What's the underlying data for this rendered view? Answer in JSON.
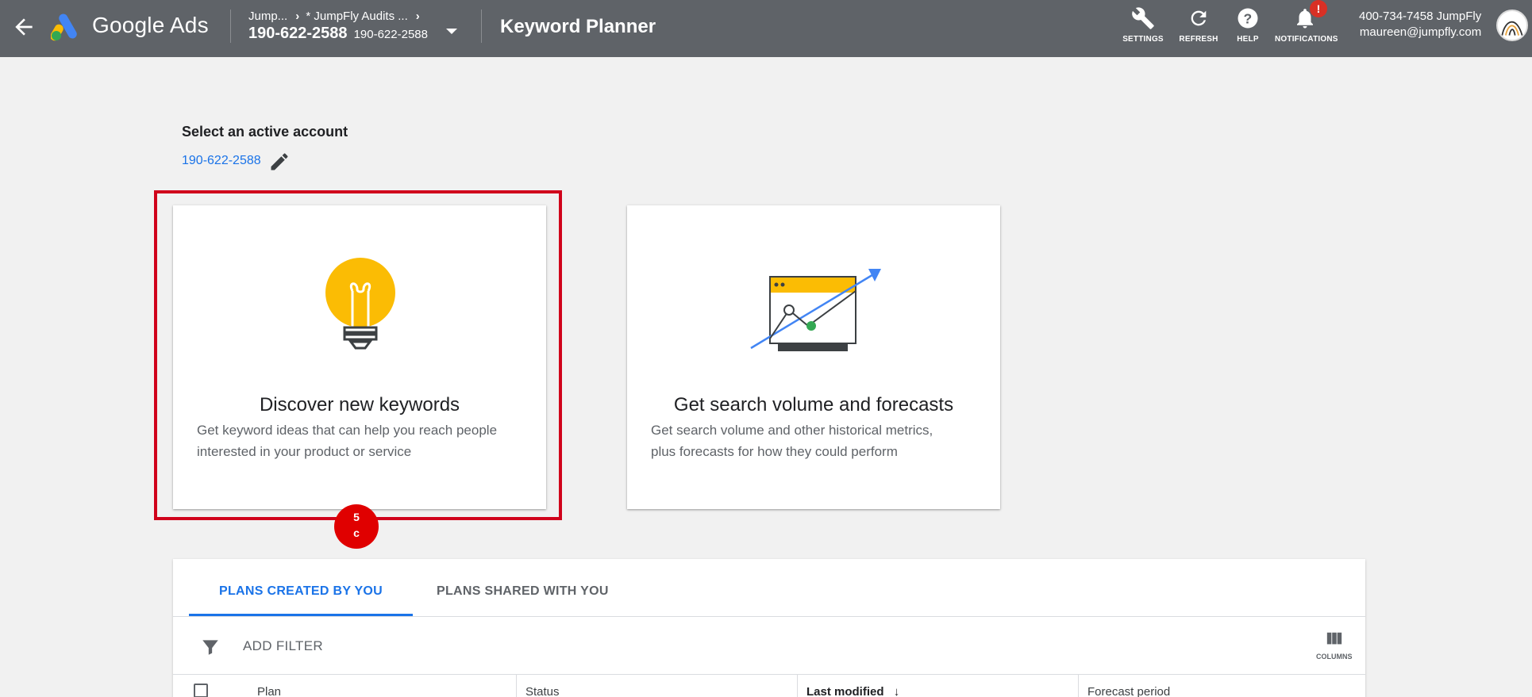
{
  "header": {
    "brand": "Google Ads",
    "breadcrumb": {
      "item1": "Jump...",
      "item2": "* JumpFly Audits ...",
      "account_id": "190-622-2588",
      "account_sub": "190-622-2588"
    },
    "page_title": "Keyword Planner",
    "tools": {
      "settings": "SETTINGS",
      "refresh": "REFRESH",
      "help": "HELP",
      "notifications": "NOTIFICATIONS",
      "notification_badge": "!"
    },
    "account": {
      "line1": "400-734-7458 JumpFly",
      "line2": "maureen@jumpfly.com"
    }
  },
  "account_selector": {
    "label": "Select an active account",
    "value": "190-622-2588"
  },
  "cards": [
    {
      "title": "Discover new keywords",
      "description_line1": "Get keyword ideas that can help you reach people",
      "description_line2": "interested in your product or service"
    },
    {
      "title": "Get search volume and forecasts",
      "description_line1": "Get search volume and other historical metrics,",
      "description_line2": "plus forecasts for how they could perform"
    }
  ],
  "annotation": {
    "step_line1": "5",
    "step_line2": "c",
    "highlight_color": "#d0021b"
  },
  "plans": {
    "tabs": [
      {
        "label": "PLANS CREATED BY YOU",
        "active": true
      },
      {
        "label": "PLANS SHARED WITH YOU",
        "active": false
      }
    ],
    "filter_label": "ADD FILTER",
    "columns_label": "COLUMNS",
    "table_headers": [
      "Plan",
      "Status",
      "Last modified",
      "Forecast period"
    ]
  },
  "colors": {
    "header_bg": "#5f6368",
    "accent": "#1a73e8",
    "bulb": "#fbbc04",
    "green": "#34a853"
  }
}
